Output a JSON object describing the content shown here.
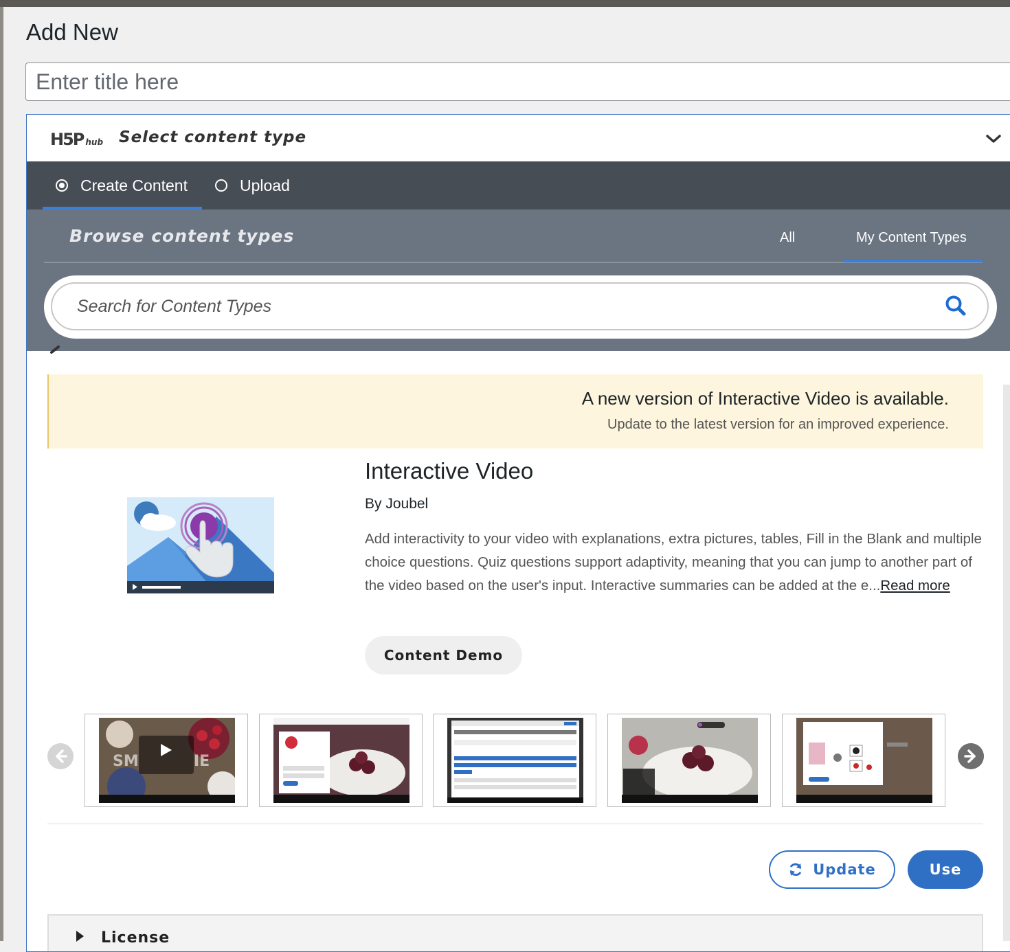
{
  "page": {
    "title": "Add New"
  },
  "title_field": {
    "placeholder": "Enter title here"
  },
  "hub": {
    "logo_text": "H5P",
    "logo_suffix": "hub",
    "select_label": "Select content type",
    "tabs": [
      {
        "label": "Create Content",
        "selected": true
      },
      {
        "label": "Upload",
        "selected": false
      }
    ],
    "browse_title": "Browse content types",
    "filters": {
      "all": "All",
      "mine": "My Content Types",
      "active": "My Content Types"
    },
    "search_placeholder": "Search for Content Types"
  },
  "notice": {
    "title": "A new version of Interactive Video is available.",
    "subtitle": "Update to the latest version for an improved experience."
  },
  "content_type": {
    "title": "Interactive Video",
    "author": "By Joubel",
    "description": "Add interactivity to your video with explanations, extra pictures, tables, Fill in the Blank and multiple choice questions. Quiz questions support adaptivity, meaning that you can jump to another part of the video based on the user's input. Interactive summaries can be added at the e...",
    "read_more": "Read more",
    "demo_label": "Content Demo",
    "screenshots": [
      {
        "name": "smoothie-intro"
      },
      {
        "name": "strawberry-editor"
      },
      {
        "name": "multiple-choice-editor"
      },
      {
        "name": "strawberry-bowl"
      },
      {
        "name": "drag-and-drop"
      }
    ],
    "update_label": "Update",
    "use_label": "Use"
  },
  "license": {
    "label": "License"
  },
  "colors": {
    "accent": "#2f6fc4",
    "tabbar": "#474d55",
    "browse": "#6b7481",
    "notice_bg": "#fdf5dd"
  }
}
